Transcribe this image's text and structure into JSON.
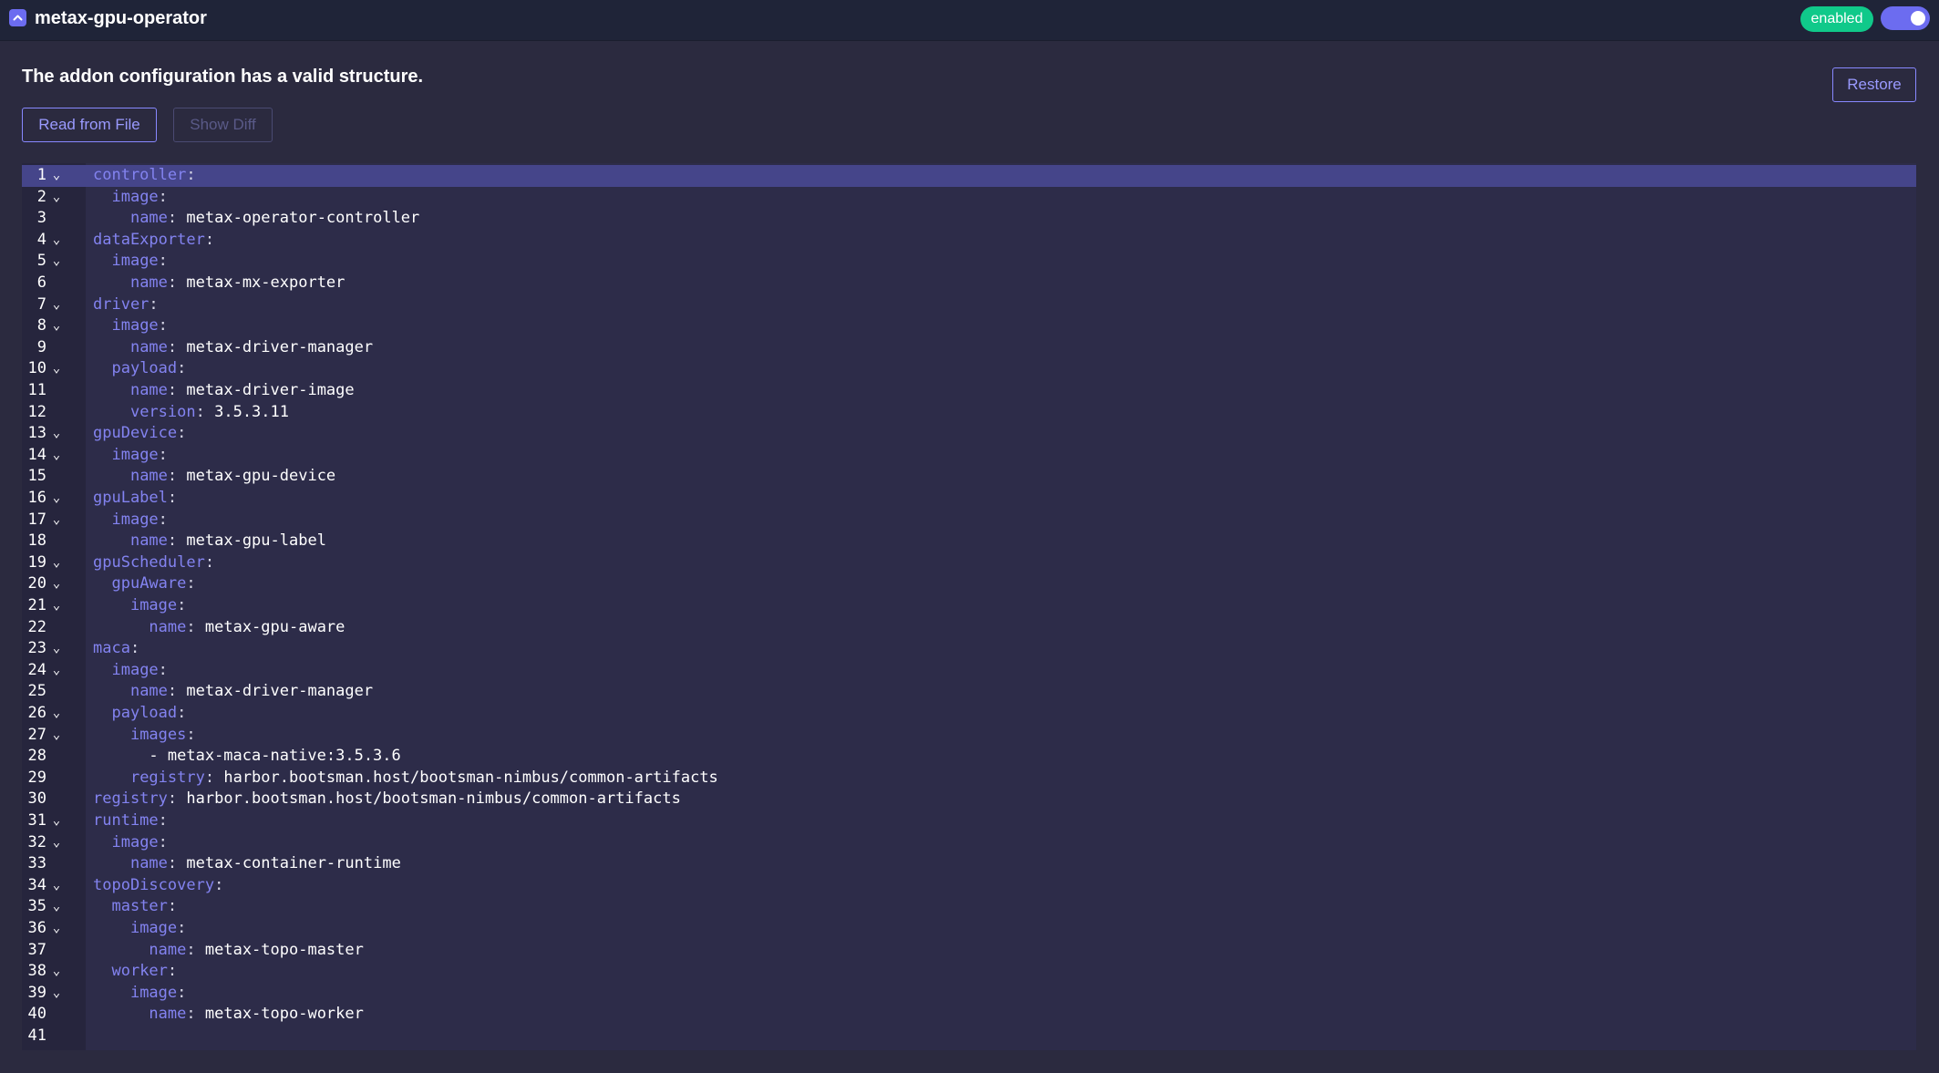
{
  "header": {
    "title": "metax-gpu-operator",
    "status": "enabled",
    "toggle_on": true
  },
  "main": {
    "validation_message": "The addon configuration has a valid structure.",
    "read_button": "Read from File",
    "diff_button": "Show Diff",
    "restore_button": "Restore"
  },
  "colors": {
    "accent": "#6c6cf0",
    "badge": "#10c98a",
    "key": "#8383f0",
    "background": "#2b2a3f"
  },
  "editor": {
    "active_line": 1,
    "lines": [
      {
        "n": "1",
        "fold": true,
        "indent": 0,
        "key": "controller",
        "value": ""
      },
      {
        "n": "2",
        "fold": true,
        "indent": 1,
        "key": "image",
        "value": ""
      },
      {
        "n": "3",
        "fold": false,
        "indent": 2,
        "key": "name",
        "value": "metax-operator-controller"
      },
      {
        "n": "4",
        "fold": true,
        "indent": 0,
        "key": "dataExporter",
        "value": ""
      },
      {
        "n": "5",
        "fold": true,
        "indent": 1,
        "key": "image",
        "value": ""
      },
      {
        "n": "6",
        "fold": false,
        "indent": 2,
        "key": "name",
        "value": "metax-mx-exporter"
      },
      {
        "n": "7",
        "fold": true,
        "indent": 0,
        "key": "driver",
        "value": ""
      },
      {
        "n": "8",
        "fold": true,
        "indent": 1,
        "key": "image",
        "value": ""
      },
      {
        "n": "9",
        "fold": false,
        "indent": 2,
        "key": "name",
        "value": "metax-driver-manager"
      },
      {
        "n": "10",
        "fold": true,
        "indent": 1,
        "key": "payload",
        "value": ""
      },
      {
        "n": "11",
        "fold": false,
        "indent": 2,
        "key": "name",
        "value": "metax-driver-image"
      },
      {
        "n": "12",
        "fold": false,
        "indent": 2,
        "key": "version",
        "value": "3.5.3.11"
      },
      {
        "n": "13",
        "fold": true,
        "indent": 0,
        "key": "gpuDevice",
        "value": ""
      },
      {
        "n": "14",
        "fold": true,
        "indent": 1,
        "key": "image",
        "value": ""
      },
      {
        "n": "15",
        "fold": false,
        "indent": 2,
        "key": "name",
        "value": "metax-gpu-device"
      },
      {
        "n": "16",
        "fold": true,
        "indent": 0,
        "key": "gpuLabel",
        "value": ""
      },
      {
        "n": "17",
        "fold": true,
        "indent": 1,
        "key": "image",
        "value": ""
      },
      {
        "n": "18",
        "fold": false,
        "indent": 2,
        "key": "name",
        "value": "metax-gpu-label"
      },
      {
        "n": "19",
        "fold": true,
        "indent": 0,
        "key": "gpuScheduler",
        "value": ""
      },
      {
        "n": "20",
        "fold": true,
        "indent": 1,
        "key": "gpuAware",
        "value": ""
      },
      {
        "n": "21",
        "fold": true,
        "indent": 2,
        "key": "image",
        "value": ""
      },
      {
        "n": "22",
        "fold": false,
        "indent": 3,
        "key": "name",
        "value": "metax-gpu-aware"
      },
      {
        "n": "23",
        "fold": true,
        "indent": 0,
        "key": "maca",
        "value": ""
      },
      {
        "n": "24",
        "fold": true,
        "indent": 1,
        "key": "image",
        "value": ""
      },
      {
        "n": "25",
        "fold": false,
        "indent": 2,
        "key": "name",
        "value": "metax-driver-manager"
      },
      {
        "n": "26",
        "fold": true,
        "indent": 1,
        "key": "payload",
        "value": ""
      },
      {
        "n": "27",
        "fold": true,
        "indent": 2,
        "key": "images",
        "value": ""
      },
      {
        "n": "28",
        "fold": false,
        "indent": 3,
        "key": "",
        "value": "- metax-maca-native:3.5.3.6"
      },
      {
        "n": "29",
        "fold": false,
        "indent": 2,
        "key": "registry",
        "value": "harbor.bootsman.host/bootsman-nimbus/common-artifacts"
      },
      {
        "n": "30",
        "fold": false,
        "indent": 0,
        "key": "registry",
        "value": "harbor.bootsman.host/bootsman-nimbus/common-artifacts"
      },
      {
        "n": "31",
        "fold": true,
        "indent": 0,
        "key": "runtime",
        "value": ""
      },
      {
        "n": "32",
        "fold": true,
        "indent": 1,
        "key": "image",
        "value": ""
      },
      {
        "n": "33",
        "fold": false,
        "indent": 2,
        "key": "name",
        "value": "metax-container-runtime"
      },
      {
        "n": "34",
        "fold": true,
        "indent": 0,
        "key": "topoDiscovery",
        "value": ""
      },
      {
        "n": "35",
        "fold": true,
        "indent": 1,
        "key": "master",
        "value": ""
      },
      {
        "n": "36",
        "fold": true,
        "indent": 2,
        "key": "image",
        "value": ""
      },
      {
        "n": "37",
        "fold": false,
        "indent": 3,
        "key": "name",
        "value": "metax-topo-master"
      },
      {
        "n": "38",
        "fold": true,
        "indent": 1,
        "key": "worker",
        "value": ""
      },
      {
        "n": "39",
        "fold": true,
        "indent": 2,
        "key": "image",
        "value": ""
      },
      {
        "n": "40",
        "fold": false,
        "indent": 3,
        "key": "name",
        "value": "metax-topo-worker"
      },
      {
        "n": "41",
        "fold": false,
        "indent": 0,
        "key": "",
        "value": ""
      }
    ]
  }
}
